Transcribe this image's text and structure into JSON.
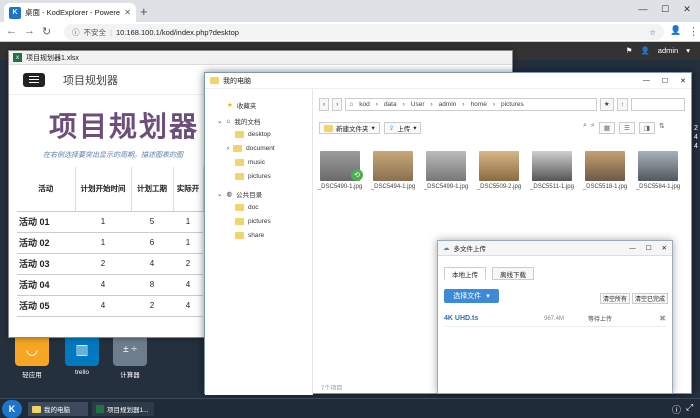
{
  "browser": {
    "tab_title": "桌面 - KodExplorer - Powered",
    "tab_favicon": "K",
    "new_tab": "+",
    "security": "不安全",
    "url": "10.168.100.1/kod/index.php?desktop",
    "window_min": "—",
    "window_max": "☐",
    "window_close": "✕"
  },
  "kod": {
    "user": "admin",
    "flag": "⚑"
  },
  "desktop_icons": [
    {
      "label": "轻应用",
      "color": "#f5a623",
      "glyph": "◡"
    },
    {
      "label": "trello",
      "color": "#0079bf",
      "glyph": "▥"
    },
    {
      "label": "计算器",
      "color": "#6e7d8c",
      "glyph": "±"
    }
  ],
  "excel": {
    "title": "项目规划器1.xlsx",
    "header": "项目规划器",
    "big_title": "项目规划器",
    "subtitle": "在右侧选择要突出显示的周期。描述图表的图",
    "columns": [
      "活动",
      "计划开始时间",
      "计划工期",
      "实际开"
    ],
    "rows": [
      [
        "活动 01",
        "1",
        "5",
        "1"
      ],
      [
        "活动 02",
        "1",
        "6",
        "1"
      ],
      [
        "活动 03",
        "2",
        "4",
        "2"
      ],
      [
        "活动 04",
        "4",
        "8",
        "4"
      ],
      [
        "活动 05",
        "4",
        "2",
        "4"
      ]
    ]
  },
  "explorer": {
    "title": "我的电脑",
    "sidebar": {
      "favorites": "收藏夹",
      "my_docs": "我的文档",
      "folders": [
        "desktop",
        "document",
        "music",
        "pictures"
      ],
      "public": "公共目录",
      "public_folders": [
        "doc",
        "pictures",
        "share"
      ]
    },
    "breadcrumb": [
      "kod",
      "data",
      "User",
      "admin",
      "home",
      "pictures"
    ],
    "new_folder": "新建文件夹",
    "upload": "上传",
    "item_count": "7个项目",
    "files": [
      "_DSC5490-1.jpg",
      "_DSC5494-1.jpg",
      "_DSC5499-1.jpg",
      "_DSC5509-2.jpg",
      "_DSC5511-1.jpg",
      "_DSC5518-1.jpg",
      "_DSC5584-1.jpg"
    ],
    "right_edge": [
      "2",
      "4",
      "4"
    ]
  },
  "upload": {
    "title": "多文件上传",
    "tab_local": "本地上传",
    "tab_remote": "离线下载",
    "select": "选择文件",
    "clear_all": "清空所有",
    "clear_done": "清空已完成",
    "file_name": "4K UHD.ts",
    "file_size": "967.4M",
    "status": "等待上传",
    "remove": "✖"
  },
  "taskbar": {
    "start": "K",
    "tasks": [
      "我的电脑",
      "项目规划器1..."
    ]
  }
}
